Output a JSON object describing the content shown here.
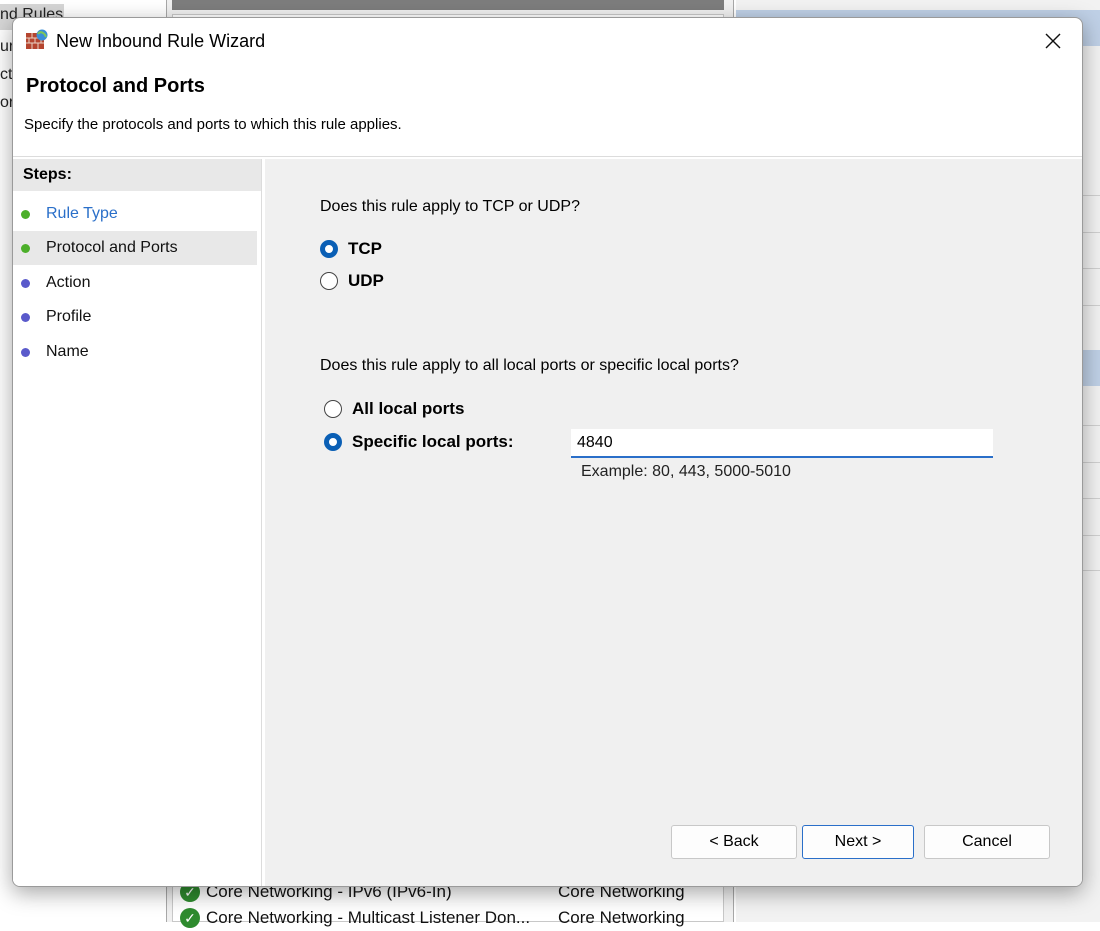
{
  "background": {
    "left_fragments": [
      "nd Rules",
      "ur",
      "cti",
      "ori"
    ],
    "rows": [
      {
        "name": "Core Networking - IPv6 (IPv6-In)",
        "group": "Core Networking"
      },
      {
        "name": "Core Networking - Multicast Listener Don...",
        "group": "Core Networking"
      }
    ]
  },
  "dialog": {
    "title": "New Inbound Rule Wizard",
    "page_title": "Protocol and Ports",
    "page_subtitle": "Specify the protocols and ports to which this rule applies.",
    "steps_header": "Steps:",
    "steps": [
      {
        "label": "Rule Type",
        "status": "completed"
      },
      {
        "label": "Protocol and Ports",
        "status": "current"
      },
      {
        "label": "Action",
        "status": "pending"
      },
      {
        "label": "Profile",
        "status": "pending"
      },
      {
        "label": "Name",
        "status": "pending"
      }
    ],
    "protocol_question": "Does this rule apply to TCP or UDP?",
    "protocol_options": [
      {
        "label": "TCP",
        "selected": true
      },
      {
        "label": "UDP",
        "selected": false
      }
    ],
    "ports_question": "Does this rule apply to all local ports or specific local ports?",
    "port_options": [
      {
        "label": "All local ports",
        "selected": false
      },
      {
        "label": "Specific local ports:",
        "selected": true
      }
    ],
    "ports_value": "4840",
    "ports_example": "Example: 80, 443, 5000-5010",
    "buttons": {
      "back": "< Back",
      "next": "Next >",
      "cancel": "Cancel"
    }
  },
  "colors": {
    "accent": "#0a5fb5",
    "link": "#2a6fc9",
    "step_completed": "#4caf2a",
    "step_pending": "#5a5acb"
  }
}
